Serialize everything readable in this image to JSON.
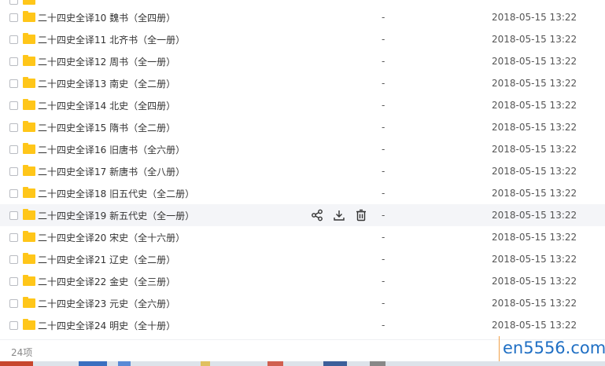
{
  "rows": [
    {
      "name": "二十四史全译10 魏书（全四册）",
      "size": "-",
      "date": "2018-05-15 13:22"
    },
    {
      "name": "二十四史全译11 北齐书（全一册）",
      "size": "-",
      "date": "2018-05-15 13:22"
    },
    {
      "name": "二十四史全译12 周书（全一册）",
      "size": "-",
      "date": "2018-05-15 13:22"
    },
    {
      "name": "二十四史全译13 南史（全二册）",
      "size": "-",
      "date": "2018-05-15 13:22"
    },
    {
      "name": "二十四史全译14 北史（全四册）",
      "size": "-",
      "date": "2018-05-15 13:22"
    },
    {
      "name": "二十四史全译15 隋书（全二册）",
      "size": "-",
      "date": "2018-05-15 13:22"
    },
    {
      "name": "二十四史全译16 旧唐书（全六册）",
      "size": "-",
      "date": "2018-05-15 13:22"
    },
    {
      "name": "二十四史全译17 新唐书（全八册）",
      "size": "-",
      "date": "2018-05-15 13:22"
    },
    {
      "name": "二十四史全译18 旧五代史（全二册）",
      "size": "-",
      "date": "2018-05-15 13:22"
    },
    {
      "name": "二十四史全译19 新五代史（全一册）",
      "size": "-",
      "date": "2018-05-15 13:22"
    },
    {
      "name": "二十四史全译20 宋史（全十六册）",
      "size": "-",
      "date": "2018-05-15 13:22"
    },
    {
      "name": "二十四史全译21 辽史（全二册）",
      "size": "-",
      "date": "2018-05-15 13:22"
    },
    {
      "name": "二十四史全译22 金史（全三册）",
      "size": "-",
      "date": "2018-05-15 13:22"
    },
    {
      "name": "二十四史全译23 元史（全六册）",
      "size": "-",
      "date": "2018-05-15 13:22"
    },
    {
      "name": "二十四史全译24 明史（全十册）",
      "size": "-",
      "date": "2018-05-15 13:22"
    }
  ],
  "hover_row_index": 9,
  "row_actions": {
    "share": "share-icon",
    "download": "download-icon",
    "delete": "trash-icon"
  },
  "footer": {
    "count": "24项"
  },
  "watermark": {
    "text": "en5556.com"
  },
  "colors": {
    "folder": "#ffc619",
    "hover_bg": "#f4f5f8",
    "watermark": "#1f6fc4"
  }
}
